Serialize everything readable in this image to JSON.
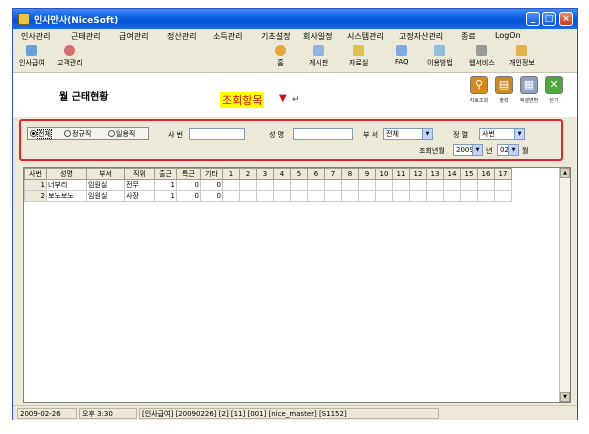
{
  "window": {
    "title": "인사만사(NiceSoft)"
  },
  "menu": [
    "인사관리",
    "근태관리",
    "급여관리",
    "정산관리",
    "소득관리",
    "기초설정",
    "회사일정",
    "시스템관리",
    "고정자산관리",
    "종료",
    "LogOn"
  ],
  "toolbar": {
    "left": [
      "인사급여",
      "고객관리"
    ],
    "right": [
      "홈",
      "게시판",
      "자료실",
      "FAQ",
      "이용방법",
      "웹서비스",
      "개인정보"
    ]
  },
  "page": {
    "title": "월 근태현황",
    "annotation": "조회항목",
    "annotation_arrow": "▼",
    "annotation_return": "↵"
  },
  "header_buttons": [
    "자료조회",
    "출력",
    "엑셀변환",
    "닫기"
  ],
  "filter": {
    "radio": [
      "전체",
      "정규직",
      "일용직"
    ],
    "selected_radio": "전체",
    "sabeon_label": "사 번",
    "sabeon_value": "",
    "name_label": "성 명",
    "name_value": "",
    "dept_label": "부 서",
    "dept_value": "전체",
    "sort_label": "정 렬",
    "sort_value": "사번",
    "period_label": "조회년월",
    "year_value": "2009",
    "year_suffix": "년",
    "month_value": "02",
    "month_suffix": "월"
  },
  "grid": {
    "columns": [
      "사번",
      "성명",
      "부서",
      "직위",
      "출근",
      "특근",
      "기타",
      "1",
      "2",
      "3",
      "4",
      "5",
      "6",
      "7",
      "8",
      "9",
      "10",
      "11",
      "12",
      "13",
      "14",
      "15",
      "16",
      "17"
    ],
    "rows": [
      [
        "1",
        "너부리",
        "임원실",
        "전무",
        "1",
        "0",
        "0"
      ],
      [
        "2",
        "보노보노",
        "임원실",
        "사장",
        "1",
        "0",
        "0"
      ]
    ]
  },
  "status": [
    "2009-02-26",
    "오후 3:30",
    "[인사급여] [20090226] [2] [11] [001] [nice_master] [S1152]"
  ]
}
